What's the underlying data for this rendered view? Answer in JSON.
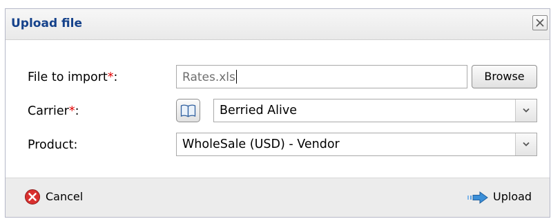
{
  "dialog": {
    "title": "Upload file",
    "close_icon": "close-icon"
  },
  "form": {
    "file_label": "File to import",
    "file_required": "*",
    "file_label_suffix": ":",
    "file_value": "Rates.xls",
    "browse_label": "Browse",
    "carrier_label": "Carrier",
    "carrier_required": "*",
    "carrier_label_suffix": ":",
    "carrier_lookup_icon": "book-icon",
    "carrier_value": "Berried Alive",
    "product_label": "Product:",
    "product_value": "WholeSale (USD) - Vendor"
  },
  "footer": {
    "cancel_label": "Cancel",
    "cancel_icon": "cancel-icon",
    "upload_label": "Upload",
    "upload_icon": "arrow-right-icon"
  },
  "colors": {
    "title": "#15428b",
    "required": "#e20000",
    "cancel_icon": "#d9302f",
    "upload_icon": "#3b8fd8"
  }
}
